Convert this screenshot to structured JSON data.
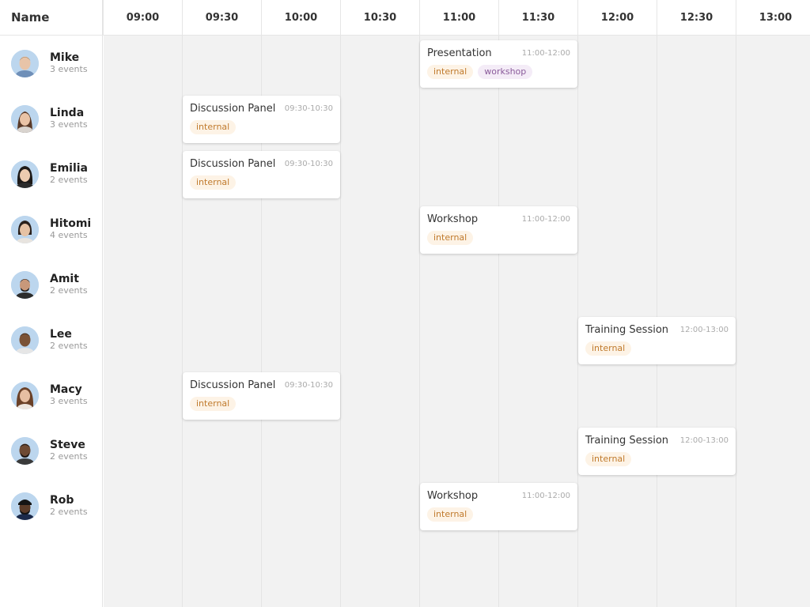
{
  "header": {
    "name_label": "Name"
  },
  "times": [
    "09:00",
    "09:30",
    "10:00",
    "10:30",
    "11:00",
    "11:30",
    "12:00",
    "12:30",
    "13:00"
  ],
  "people": [
    {
      "name": "Mike",
      "events": "3 events",
      "avatar_color": "#bcd6ee",
      "skin": "#e8c4a8",
      "hair": "#a08060"
    },
    {
      "name": "Linda",
      "events": "3 events",
      "avatar_color": "#bcd6ee",
      "skin": "#e9c3a6",
      "hair": "#5a3a28"
    },
    {
      "name": "Emilia",
      "events": "2 events",
      "avatar_color": "#bcd6ee",
      "skin": "#eccbb0",
      "hair": "#1e1a18"
    },
    {
      "name": "Hitomi",
      "events": "4 events",
      "avatar_color": "#bcd6ee",
      "skin": "#e6c2a4",
      "hair": "#2a211c"
    },
    {
      "name": "Amit",
      "events": "2 events",
      "avatar_color": "#bcd6ee",
      "skin": "#c8987a",
      "hair": "#1f1a17"
    },
    {
      "name": "Lee",
      "events": "2 events",
      "avatar_color": "#bcd6ee",
      "skin": "#7a5236",
      "hair": "#2a1d15"
    },
    {
      "name": "Macy",
      "events": "3 events",
      "avatar_color": "#bcd6ee",
      "skin": "#e6bea2",
      "hair": "#6b4128"
    },
    {
      "name": "Steve",
      "events": "2 events",
      "avatar_color": "#bcd6ee",
      "skin": "#6e4a33",
      "hair": "#1e1612"
    },
    {
      "name": "Rob",
      "events": "2 events",
      "avatar_color": "#bcd6ee",
      "skin": "#5a3b28",
      "hair": "#141414"
    }
  ],
  "events": [
    {
      "title": "Presentation",
      "time": "11:00-12:00",
      "tags": [
        "internal",
        "workshop"
      ]
    },
    {
      "title": "Discussion Panel",
      "time": "09:30-10:30",
      "tags": [
        "internal"
      ]
    },
    {
      "title": "Discussion Panel",
      "time": "09:30-10:30",
      "tags": [
        "internal"
      ]
    },
    {
      "title": "Workshop",
      "time": "11:00-12:00",
      "tags": [
        "internal"
      ]
    },
    {
      "title": "Training Session",
      "time": "12:00-13:00",
      "tags": [
        "internal"
      ]
    },
    {
      "title": "Discussion Panel",
      "time": "09:30-10:30",
      "tags": [
        "internal"
      ]
    },
    {
      "title": "Training Session",
      "time": "12:00-13:00",
      "tags": [
        "internal"
      ]
    },
    {
      "title": "Workshop",
      "time": "11:00-12:00",
      "tags": [
        "internal"
      ]
    }
  ],
  "colors": {
    "grid_background": "#f2f2f2",
    "tag_internal_bg": "#fdf3e6",
    "tag_internal_text": "#c07a2c",
    "tag_workshop_bg": "#f4ecf7",
    "tag_workshop_text": "#8a5b9b"
  }
}
